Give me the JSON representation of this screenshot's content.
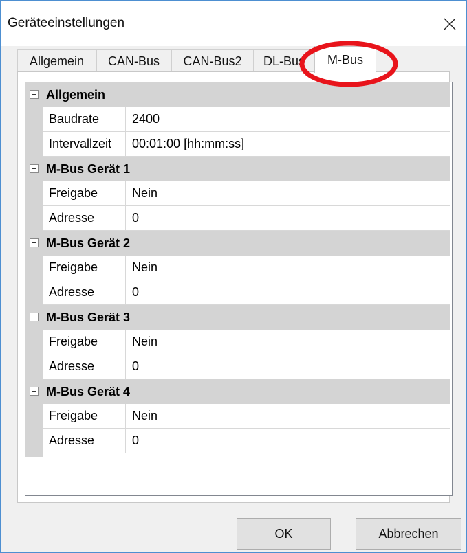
{
  "window": {
    "title": "Geräteeinstellungen",
    "close_icon": "close-icon"
  },
  "tabs": [
    {
      "label": "Allgemein",
      "active": false
    },
    {
      "label": "CAN-Bus",
      "active": false
    },
    {
      "label": "CAN-Bus2",
      "active": false
    },
    {
      "label": "DL-Bus",
      "active": false
    },
    {
      "label": "M-Bus",
      "active": true
    }
  ],
  "annotation": {
    "shape": "ellipse",
    "color": "#e8141b",
    "target": "M-Bus tab"
  },
  "grid": {
    "categories": [
      {
        "label": "Allgemein",
        "properties": [
          {
            "name": "Baudrate",
            "value": "2400"
          },
          {
            "name": "Intervallzeit",
            "value": "00:01:00 [hh:mm:ss]"
          }
        ]
      },
      {
        "label": "M-Bus Gerät 1",
        "properties": [
          {
            "name": "Freigabe",
            "value": "Nein"
          },
          {
            "name": "Adresse",
            "value": "0"
          }
        ]
      },
      {
        "label": "M-Bus Gerät 2",
        "properties": [
          {
            "name": "Freigabe",
            "value": "Nein"
          },
          {
            "name": "Adresse",
            "value": "0"
          }
        ]
      },
      {
        "label": "M-Bus Gerät 3",
        "properties": [
          {
            "name": "Freigabe",
            "value": "Nein"
          },
          {
            "name": "Adresse",
            "value": "0"
          }
        ]
      },
      {
        "label": "M-Bus Gerät 4",
        "properties": [
          {
            "name": "Freigabe",
            "value": "Nein"
          },
          {
            "name": "Adresse",
            "value": "0"
          }
        ]
      }
    ]
  },
  "buttons": {
    "ok_label": "OK",
    "cancel_label": "Abbrechen"
  }
}
